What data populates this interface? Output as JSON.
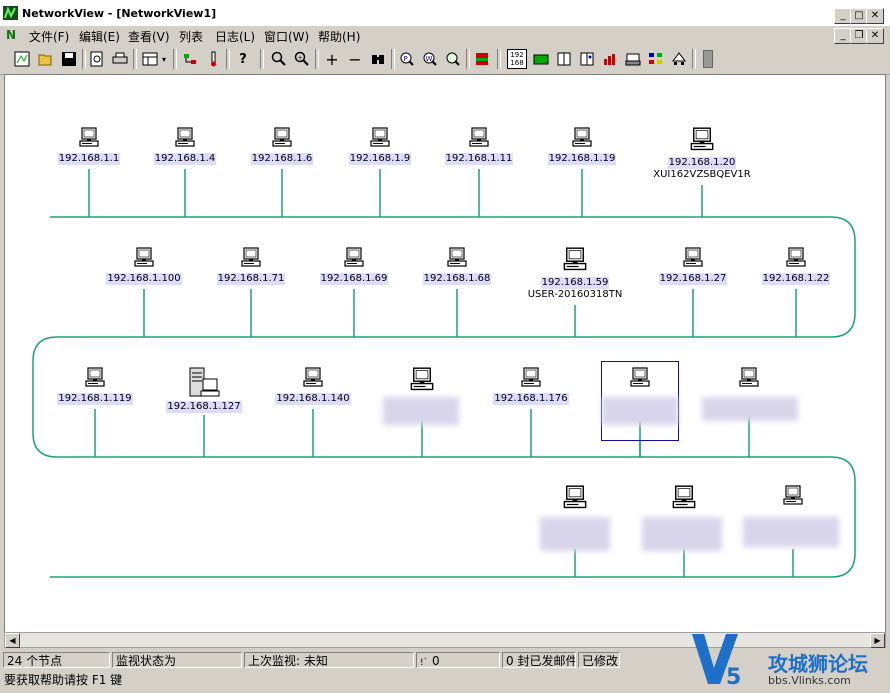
{
  "window": {
    "title": "NetworkView - [NetworkView1]"
  },
  "menu": [
    "文件(F)",
    "编辑(E)",
    "查看(V)",
    "列表",
    "日志(L)",
    "窗口(W)",
    "帮助(H)"
  ],
  "toolbar": {
    "icons": [
      "new-icon",
      "open-icon",
      "save-icon",
      "preview-icon",
      "print-icon",
      "view-grid-icon",
      "dropdown-icon",
      "connect-icon",
      "thermometer-icon",
      "help-icon",
      "zoom-in-icon",
      "zoom-fit-icon",
      "add-icon",
      "remove-icon",
      "find-icon",
      "ping-icon",
      "web-icon",
      "lookup-icon",
      "snmp-icon",
      "ip-label-icon",
      "card-icon",
      "book-icon",
      "book2-icon",
      "chart-icon",
      "printer-icon",
      "group-icon",
      "tree-icon",
      "gray-icon"
    ],
    "ip_label_top": "192",
    "ip_label_bottom": "168"
  },
  "rows": [
    {
      "nodes": [
        {
          "label": "192.168.1.1"
        },
        {
          "label": "192.168.1.4"
        },
        {
          "label": "192.168.1.6"
        },
        {
          "label": "192.168.1.9"
        },
        {
          "label": "192.168.1.11"
        },
        {
          "label": "192.168.1.19"
        },
        {
          "label": "192.168.1.20",
          "sub": "XUI162VZSBQEV1R"
        }
      ]
    },
    {
      "nodes": [
        {
          "label": "192.168.1.100"
        },
        {
          "label": "192.168.1.71"
        },
        {
          "label": "192.168.1.69"
        },
        {
          "label": "192.168.1.68"
        },
        {
          "label": "192.168.1.59",
          "sub": "USER-20160318TN"
        },
        {
          "label": "192.168.1.27"
        },
        {
          "label": "192.168.1.22"
        }
      ]
    },
    {
      "nodes": [
        {
          "label": "192.168.1.119"
        },
        {
          "label": "192.168.1.127"
        },
        {
          "label": "192.168.1.140"
        },
        {
          "label": ""
        },
        {
          "label": "192.168.1.176"
        },
        {
          "label": ""
        },
        {
          "label": ""
        }
      ]
    }
  ],
  "status": {
    "nodes": "24 个节点",
    "monitor_state": "监视状态为",
    "last_monitor": "上次监视: 未知",
    "counter": "0",
    "mail": "0 封已发邮件",
    "modified": "已修改",
    "hint": "要获取帮助请按 F1 键"
  },
  "watermark": {
    "brand": "攻城狮论坛",
    "url": "bbs.Vlinks.com"
  }
}
